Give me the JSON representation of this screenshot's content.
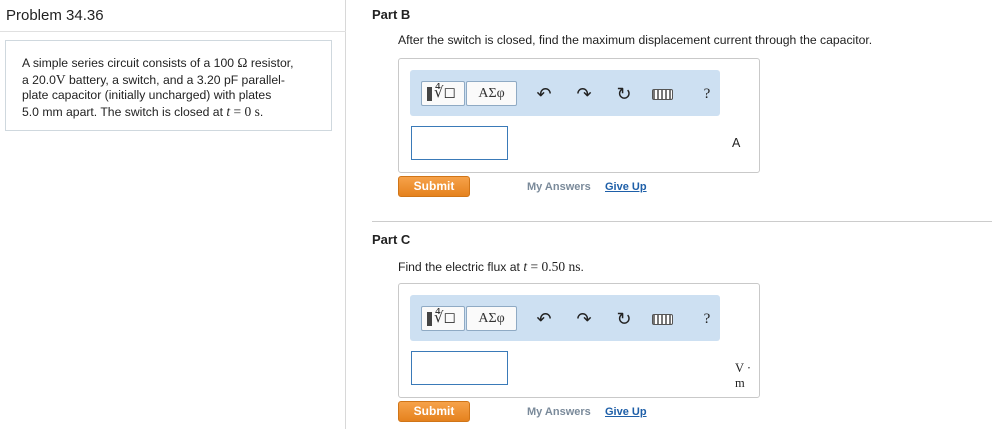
{
  "problem": {
    "title": "Problem 34.36",
    "text": {
      "l1a": "A simple series circuit consists of a 100 ",
      "l1_ohm": "Ω",
      "l1b": " resistor,",
      "l2a": "a 20.0",
      "l2_volt": "V",
      "l2b": " battery, a switch, and a 3.20 pF parallel-",
      "l3": "plate capacitor (initially uncharged) with plates",
      "l4a": "5.0 mm apart. The switch is closed at ",
      "l4_t": "t",
      "l4_eq": " = ",
      "l4_zero": "0 s",
      "l4b": "."
    }
  },
  "part_b": {
    "heading": "Part B",
    "question": "After the switch is closed, find the maximum displacement current through the capacitor.",
    "unit": "A",
    "input_value": "",
    "submit_label": "Submit",
    "my_answers_label": "My Answers",
    "give_up_label": "Give Up"
  },
  "part_c": {
    "heading": "Part C",
    "question_prefix": "Find the electric flux at ",
    "question_t": "t",
    "question_eq": " = ",
    "question_value": "0.50 ns",
    "question_suffix": ".",
    "unit": "V · m",
    "input_value": "",
    "submit_label": "Submit",
    "my_answers_label": "My Answers",
    "give_up_label": "Give Up"
  },
  "toolbar": {
    "templates_glyph": "∜◻",
    "greek_label": "ΑΣφ",
    "undo_icon": "↶",
    "redo_icon": "↷",
    "reset_icon": "↻",
    "help_label": "?"
  }
}
